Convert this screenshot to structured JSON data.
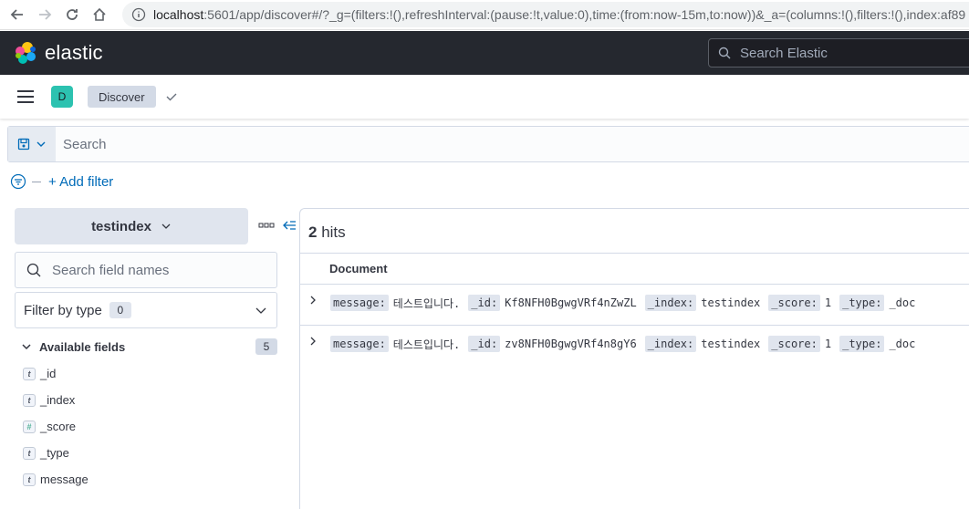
{
  "browser": {
    "url_host": "localhost",
    "url_rest": ":5601/app/discover#/?_g=(filters:!(),refreshInterval:(pause:!t,value:0),time:(from:now-15m,to:now))&_a=(columns:!(),filters:!(),index:af89"
  },
  "header": {
    "logo_text": "elastic",
    "search_placeholder": "Search Elastic"
  },
  "app_bar": {
    "space_initial": "D",
    "breadcrumb": "Discover"
  },
  "query": {
    "placeholder": "Search"
  },
  "filter": {
    "add_label": "+ Add filter"
  },
  "sidebar": {
    "index_pattern": "testindex",
    "field_search_placeholder": "Search field names",
    "filter_by_type_label": "Filter by type",
    "filter_by_type_count": "0",
    "available_fields_label": "Available fields",
    "available_fields_count": "5",
    "fields": [
      {
        "name": "_id",
        "type_glyph": "t"
      },
      {
        "name": "_index",
        "type_glyph": "t"
      },
      {
        "name": "_score",
        "type_glyph": "#"
      },
      {
        "name": "_type",
        "type_glyph": "t"
      },
      {
        "name": "message",
        "type_glyph": "t"
      }
    ]
  },
  "results": {
    "hits_count": "2",
    "hits_label": "hits",
    "column_header": "Document",
    "rows": [
      {
        "message_key": "message:",
        "message": "테스트입니다.",
        "id_key": "_id:",
        "id": "Kf8NFH0BgwgVRf4nZwZL",
        "index_key": "_index:",
        "index": "testindex",
        "score_key": "_score:",
        "score": "1",
        "type_key": "_type:",
        "type": "_doc"
      },
      {
        "message_key": "message:",
        "message": "테스트입니다.",
        "id_key": "_id:",
        "id": "zv8NFH0BgwgVRf4n8gY6",
        "index_key": "_index:",
        "index": "testindex",
        "score_key": "_score:",
        "score": "1",
        "type_key": "_type:",
        "type": "_doc"
      }
    ]
  },
  "colors": {
    "header_bg": "#25282f",
    "accent_link": "#006bb8",
    "space_avatar": "#2cc2b0"
  }
}
